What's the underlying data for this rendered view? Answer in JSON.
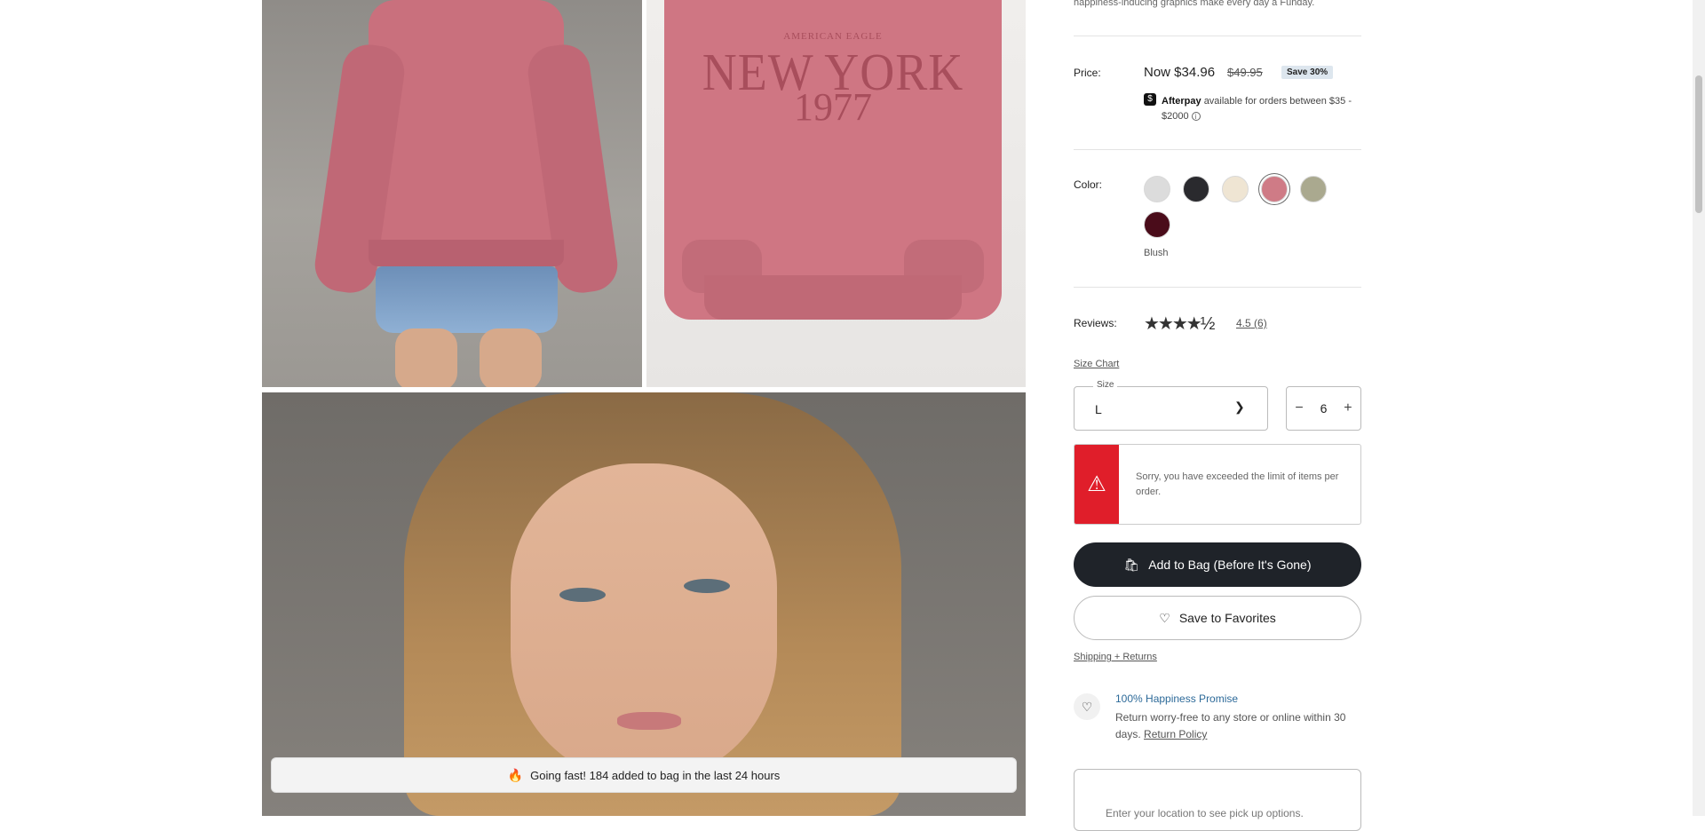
{
  "product": {
    "description_tail": "happiness-inducing graphics make every day a Funday.",
    "price_label": "Price:",
    "price_now": "Now $34.96",
    "price_was": "$49.95",
    "save_badge": "Save 30%",
    "afterpay_brand": "Afterpay",
    "afterpay_text": "available for orders between $35 - $2000",
    "color_label": "Color:",
    "colors": [
      {
        "name": "light-gray",
        "hex": "#dcdcdc"
      },
      {
        "name": "black",
        "hex": "#2a2a2e"
      },
      {
        "name": "cream",
        "hex": "#efe5d3"
      },
      {
        "name": "Blush",
        "hex": "#cf7b86",
        "selected": true
      },
      {
        "name": "olive",
        "hex": "#aaa98f"
      },
      {
        "name": "burgundy",
        "hex": "#4a0c1a"
      }
    ],
    "selected_color": "Blush",
    "reviews_label": "Reviews:",
    "rating": "4.5",
    "review_count": "(6)",
    "stars": "★★★★½"
  },
  "print": {
    "brand": "AMERICAN EAGLE",
    "city": "NEW YORK",
    "year": "1977"
  },
  "size": {
    "chart_link": "Size Chart",
    "label": "Size",
    "value": "L"
  },
  "quantity": {
    "minus": "−",
    "value": "6",
    "plus": "+"
  },
  "error": {
    "icon": "⚠",
    "message": "Sorry, you have exceeded the limit of items per order."
  },
  "actions": {
    "add_to_bag": "Add to Bag (Before It's Gone)",
    "save_favorites": "Save to Favorites",
    "shipping_link": "Shipping + Returns"
  },
  "promise": {
    "title": "100% Happiness Promise",
    "text": "Return worry-free to any store or online within 30 days.",
    "link": "Return Policy"
  },
  "pickup": {
    "placeholder": "Enter your location to see pick up options."
  },
  "toast": {
    "text": "Going fast! 184 added to bag in the last 24 hours"
  }
}
